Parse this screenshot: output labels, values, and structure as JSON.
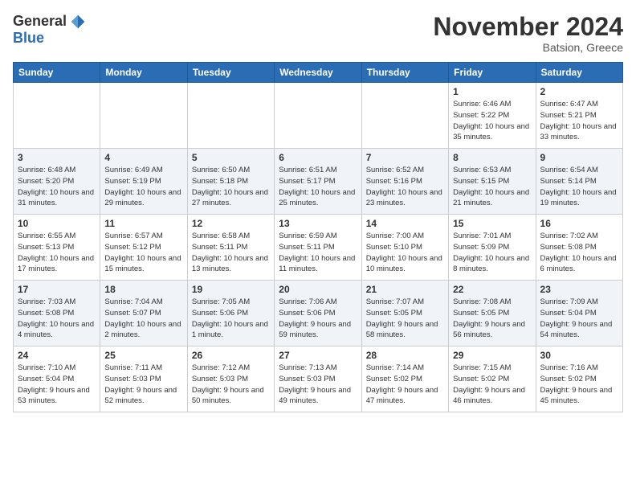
{
  "header": {
    "logo_general": "General",
    "logo_blue": "Blue",
    "month_title": "November 2024",
    "location": "Batsion, Greece"
  },
  "weekdays": [
    "Sunday",
    "Monday",
    "Tuesday",
    "Wednesday",
    "Thursday",
    "Friday",
    "Saturday"
  ],
  "weeks": [
    [
      {
        "day": "",
        "info": ""
      },
      {
        "day": "",
        "info": ""
      },
      {
        "day": "",
        "info": ""
      },
      {
        "day": "",
        "info": ""
      },
      {
        "day": "",
        "info": ""
      },
      {
        "day": "1",
        "info": "Sunrise: 6:46 AM\nSunset: 5:22 PM\nDaylight: 10 hours\nand 35 minutes."
      },
      {
        "day": "2",
        "info": "Sunrise: 6:47 AM\nSunset: 5:21 PM\nDaylight: 10 hours\nand 33 minutes."
      }
    ],
    [
      {
        "day": "3",
        "info": "Sunrise: 6:48 AM\nSunset: 5:20 PM\nDaylight: 10 hours\nand 31 minutes."
      },
      {
        "day": "4",
        "info": "Sunrise: 6:49 AM\nSunset: 5:19 PM\nDaylight: 10 hours\nand 29 minutes."
      },
      {
        "day": "5",
        "info": "Sunrise: 6:50 AM\nSunset: 5:18 PM\nDaylight: 10 hours\nand 27 minutes."
      },
      {
        "day": "6",
        "info": "Sunrise: 6:51 AM\nSunset: 5:17 PM\nDaylight: 10 hours\nand 25 minutes."
      },
      {
        "day": "7",
        "info": "Sunrise: 6:52 AM\nSunset: 5:16 PM\nDaylight: 10 hours\nand 23 minutes."
      },
      {
        "day": "8",
        "info": "Sunrise: 6:53 AM\nSunset: 5:15 PM\nDaylight: 10 hours\nand 21 minutes."
      },
      {
        "day": "9",
        "info": "Sunrise: 6:54 AM\nSunset: 5:14 PM\nDaylight: 10 hours\nand 19 minutes."
      }
    ],
    [
      {
        "day": "10",
        "info": "Sunrise: 6:55 AM\nSunset: 5:13 PM\nDaylight: 10 hours\nand 17 minutes."
      },
      {
        "day": "11",
        "info": "Sunrise: 6:57 AM\nSunset: 5:12 PM\nDaylight: 10 hours\nand 15 minutes."
      },
      {
        "day": "12",
        "info": "Sunrise: 6:58 AM\nSunset: 5:11 PM\nDaylight: 10 hours\nand 13 minutes."
      },
      {
        "day": "13",
        "info": "Sunrise: 6:59 AM\nSunset: 5:11 PM\nDaylight: 10 hours\nand 11 minutes."
      },
      {
        "day": "14",
        "info": "Sunrise: 7:00 AM\nSunset: 5:10 PM\nDaylight: 10 hours\nand 10 minutes."
      },
      {
        "day": "15",
        "info": "Sunrise: 7:01 AM\nSunset: 5:09 PM\nDaylight: 10 hours\nand 8 minutes."
      },
      {
        "day": "16",
        "info": "Sunrise: 7:02 AM\nSunset: 5:08 PM\nDaylight: 10 hours\nand 6 minutes."
      }
    ],
    [
      {
        "day": "17",
        "info": "Sunrise: 7:03 AM\nSunset: 5:08 PM\nDaylight: 10 hours\nand 4 minutes."
      },
      {
        "day": "18",
        "info": "Sunrise: 7:04 AM\nSunset: 5:07 PM\nDaylight: 10 hours\nand 2 minutes."
      },
      {
        "day": "19",
        "info": "Sunrise: 7:05 AM\nSunset: 5:06 PM\nDaylight: 10 hours\nand 1 minute."
      },
      {
        "day": "20",
        "info": "Sunrise: 7:06 AM\nSunset: 5:06 PM\nDaylight: 9 hours\nand 59 minutes."
      },
      {
        "day": "21",
        "info": "Sunrise: 7:07 AM\nSunset: 5:05 PM\nDaylight: 9 hours\nand 58 minutes."
      },
      {
        "day": "22",
        "info": "Sunrise: 7:08 AM\nSunset: 5:05 PM\nDaylight: 9 hours\nand 56 minutes."
      },
      {
        "day": "23",
        "info": "Sunrise: 7:09 AM\nSunset: 5:04 PM\nDaylight: 9 hours\nand 54 minutes."
      }
    ],
    [
      {
        "day": "24",
        "info": "Sunrise: 7:10 AM\nSunset: 5:04 PM\nDaylight: 9 hours\nand 53 minutes."
      },
      {
        "day": "25",
        "info": "Sunrise: 7:11 AM\nSunset: 5:03 PM\nDaylight: 9 hours\nand 52 minutes."
      },
      {
        "day": "26",
        "info": "Sunrise: 7:12 AM\nSunset: 5:03 PM\nDaylight: 9 hours\nand 50 minutes."
      },
      {
        "day": "27",
        "info": "Sunrise: 7:13 AM\nSunset: 5:03 PM\nDaylight: 9 hours\nand 49 minutes."
      },
      {
        "day": "28",
        "info": "Sunrise: 7:14 AM\nSunset: 5:02 PM\nDaylight: 9 hours\nand 47 minutes."
      },
      {
        "day": "29",
        "info": "Sunrise: 7:15 AM\nSunset: 5:02 PM\nDaylight: 9 hours\nand 46 minutes."
      },
      {
        "day": "30",
        "info": "Sunrise: 7:16 AM\nSunset: 5:02 PM\nDaylight: 9 hours\nand 45 minutes."
      }
    ]
  ]
}
